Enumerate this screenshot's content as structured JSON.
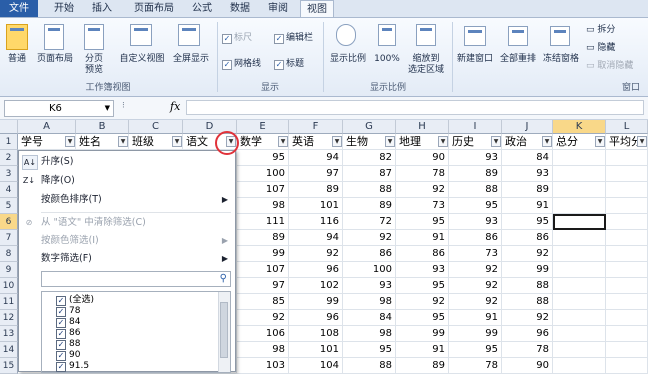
{
  "tabs": [
    "文件",
    "开始",
    "插入",
    "页面布局",
    "公式",
    "数据",
    "审阅",
    "视图"
  ],
  "ribbon": {
    "workbook_views": {
      "group_label": "工作簿视图",
      "buttons": [
        "普通",
        "页面布局",
        "分页\n预览",
        "自定义视图",
        "全屏显示"
      ]
    },
    "show": {
      "group_label": "显示",
      "checks": [
        {
          "label": "标尺",
          "checked": true,
          "enabled": false
        },
        {
          "label": "编辑栏",
          "checked": true,
          "enabled": true
        },
        {
          "label": "网格线",
          "checked": true,
          "enabled": true
        },
        {
          "label": "标题",
          "checked": true,
          "enabled": true
        }
      ]
    },
    "zoom": {
      "group_label": "显示比例",
      "buttons": [
        "显示比例",
        "100%",
        "缩放到\n选定区域"
      ]
    },
    "window": {
      "group_label": "窗口",
      "buttons": [
        "新建窗口",
        "全部重排",
        "冻结窗格"
      ],
      "small": [
        "拆分",
        "隐藏",
        "取消隐藏"
      ]
    }
  },
  "formula_bar": {
    "name_box": "K6",
    "fx": "fx"
  },
  "columns": [
    "A",
    "B",
    "C",
    "D",
    "E",
    "F",
    "G",
    "H",
    "I",
    "J",
    "K",
    "L"
  ],
  "selected_column": "K",
  "selected_row": "6",
  "header_row": [
    "学号",
    "姓名",
    "班级",
    "语文",
    "数学",
    "英语",
    "生物",
    "地理",
    "历史",
    "政治",
    "总分",
    "平均分"
  ],
  "rows": [
    [
      "2",
      "95",
      "94",
      "82",
      "90",
      "93",
      "84"
    ],
    [
      "3",
      "100",
      "97",
      "87",
      "78",
      "89",
      "93"
    ],
    [
      "4",
      "107",
      "89",
      "88",
      "92",
      "88",
      "89"
    ],
    [
      "5",
      "98",
      "101",
      "89",
      "73",
      "95",
      "91"
    ],
    [
      "6",
      "111",
      "116",
      "72",
      "95",
      "93",
      "95"
    ],
    [
      "7",
      "89",
      "94",
      "92",
      "91",
      "86",
      "86"
    ],
    [
      "8",
      "99",
      "92",
      "86",
      "86",
      "73",
      "92"
    ],
    [
      "9",
      "107",
      "96",
      "100",
      "93",
      "92",
      "99"
    ],
    [
      "10",
      "97",
      "102",
      "93",
      "95",
      "92",
      "88"
    ],
    [
      "11",
      "85",
      "99",
      "98",
      "92",
      "92",
      "88"
    ],
    [
      "12",
      "92",
      "96",
      "84",
      "95",
      "91",
      "92"
    ],
    [
      "13",
      "106",
      "108",
      "98",
      "99",
      "99",
      "96"
    ],
    [
      "14",
      "98",
      "101",
      "95",
      "91",
      "95",
      "78"
    ],
    [
      "15",
      "103",
      "104",
      "88",
      "89",
      "78",
      "90"
    ]
  ],
  "menu": {
    "sort_asc": "升序(S)",
    "sort_desc": "降序(O)",
    "sort_color": "按颜色排序(T)",
    "clear_filter": "从 \"语文\" 中清除筛选(C)",
    "filter_color": "按颜色筛选(I)",
    "number_filter": "数字筛选(F)",
    "list": [
      "(全选)",
      "78",
      "84",
      "86",
      "88",
      "90",
      "91.5"
    ]
  }
}
